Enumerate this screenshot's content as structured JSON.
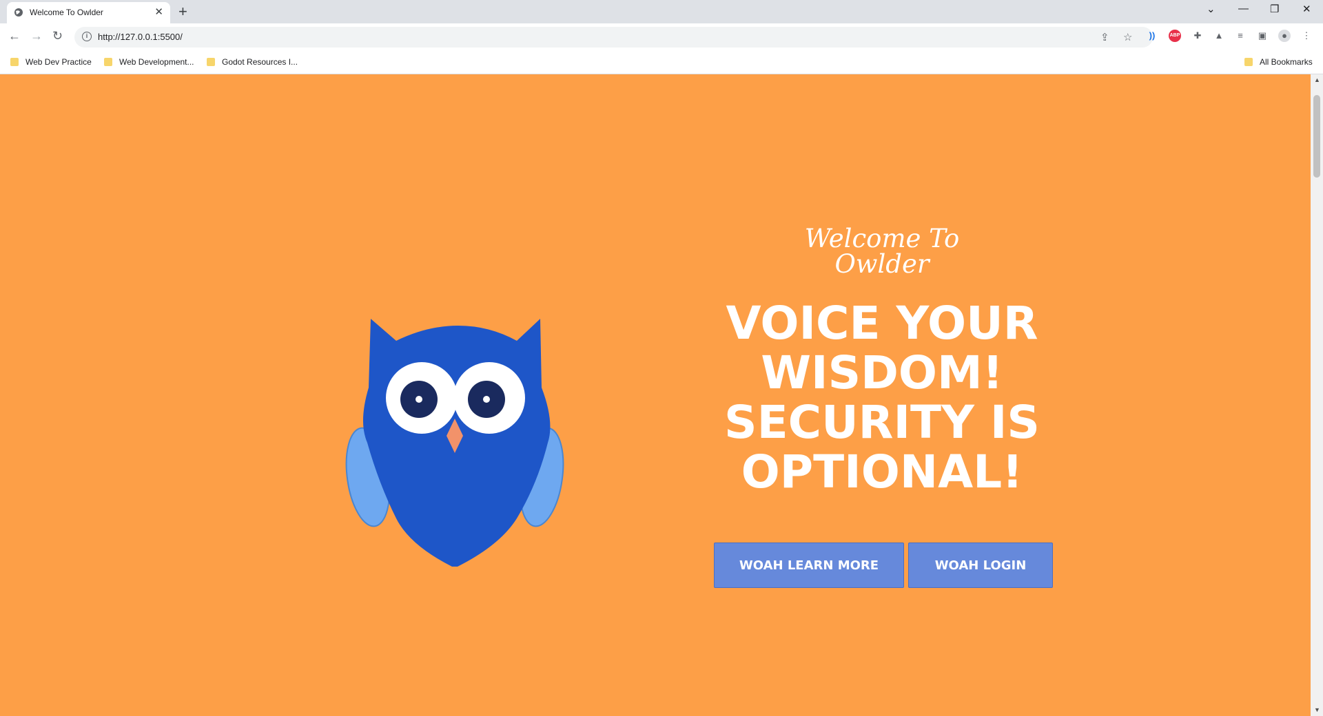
{
  "browser": {
    "tab_title": "Welcome To Owlder",
    "url": "http://127.0.0.1:5500/",
    "bookmarks": [
      "Web Dev Practice",
      "Web Development...",
      "Godot Resources I..."
    ],
    "all_bookmarks": "All Bookmarks",
    "extensions": [
      "abp-icon",
      "puzzle-icon",
      "flask-icon",
      "media-icon",
      "sidepanel-icon",
      "profile-icon"
    ]
  },
  "colors": {
    "page_bg": "#fd9f47",
    "owl_body": "#1e56c8",
    "owl_wing": "#6ea8f0",
    "button_bg": "#6689db"
  },
  "hero": {
    "welcome": "Welcome To Owlder",
    "headline_lines": [
      "VOICE YOUR",
      "WISDOM!",
      "SECURITY IS",
      "OPTIONAL!"
    ]
  },
  "buttons": {
    "learn_more": "WOAH LEARN MORE",
    "login": "WOAH LOGIN"
  }
}
